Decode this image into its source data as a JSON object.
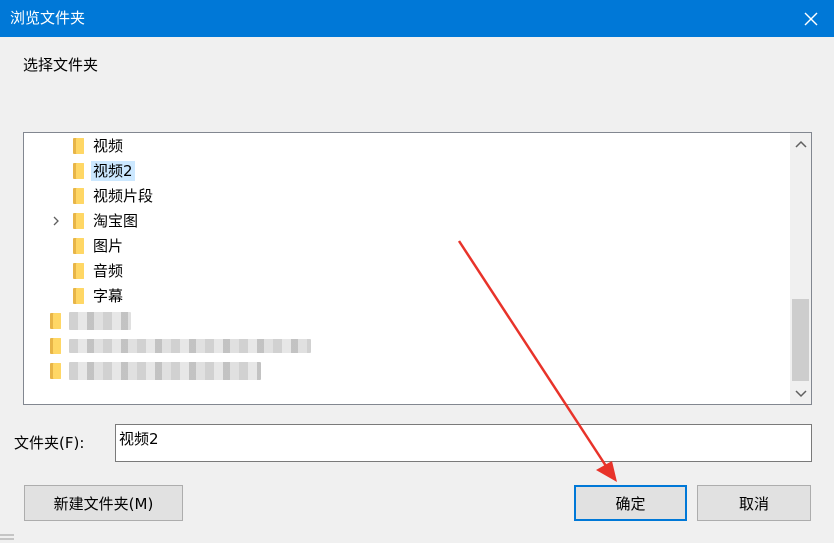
{
  "window": {
    "title": "浏览文件夹",
    "instruction": "选择文件夹"
  },
  "tree": {
    "items": [
      {
        "label": "视频",
        "expandable": false,
        "selected": false
      },
      {
        "label": "视频2",
        "expandable": false,
        "selected": true
      },
      {
        "label": "视频片段",
        "expandable": false,
        "selected": false
      },
      {
        "label": "淘宝图",
        "expandable": true,
        "selected": false
      },
      {
        "label": "图片",
        "expandable": false,
        "selected": false
      },
      {
        "label": "音频",
        "expandable": false,
        "selected": false
      },
      {
        "label": "字幕",
        "expandable": false,
        "selected": false
      }
    ],
    "blurred_items": 3
  },
  "folder_field": {
    "label": "文件夹(F):",
    "value": "视频2"
  },
  "buttons": {
    "new_folder": "新建文件夹(M)",
    "ok": "确定",
    "cancel": "取消"
  },
  "colors": {
    "titlebar": "#0078d7",
    "selection": "#cce8ff",
    "folder": "#ffd765",
    "annotation_arrow": "#e8332a"
  },
  "icons": {
    "close": "close-icon",
    "folder": "folder-icon",
    "expander": "chevron-right-icon",
    "scroll_up": "chevron-up-icon",
    "scroll_down": "chevron-down-icon"
  }
}
